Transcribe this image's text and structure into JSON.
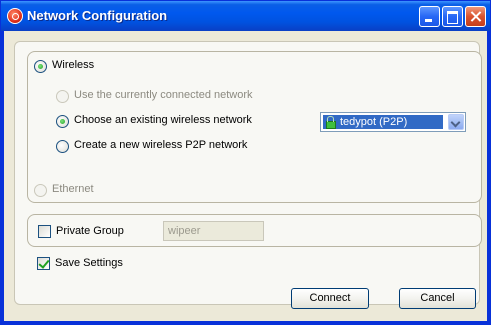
{
  "window": {
    "title": "Network Configuration"
  },
  "connection_type": {
    "wireless_label": "Wireless",
    "wireless_selected": true,
    "ethernet_label": "Ethernet",
    "ethernet_enabled": false
  },
  "wireless_options": {
    "use_current_label": "Use the currently connected network",
    "use_current_enabled": false,
    "choose_existing_label": "Choose an existing wireless network",
    "choose_existing_selected": true,
    "create_new_label": "Create a new wireless P2P network"
  },
  "network_select": {
    "selected_value": "tedypot (P2P)",
    "icon": "lock-icon"
  },
  "private_group": {
    "label": "Private Group",
    "checked": false,
    "input_value": "wipeer"
  },
  "save_settings": {
    "label": "Save Settings",
    "checked": true
  },
  "buttons": {
    "connect_label": "Connect",
    "cancel_label": "Cancel"
  },
  "colors": {
    "titlebar": "#0058ee",
    "dialog_bg": "#ece9d8",
    "selection": "#316ac5",
    "radio_check": "#21a121"
  }
}
